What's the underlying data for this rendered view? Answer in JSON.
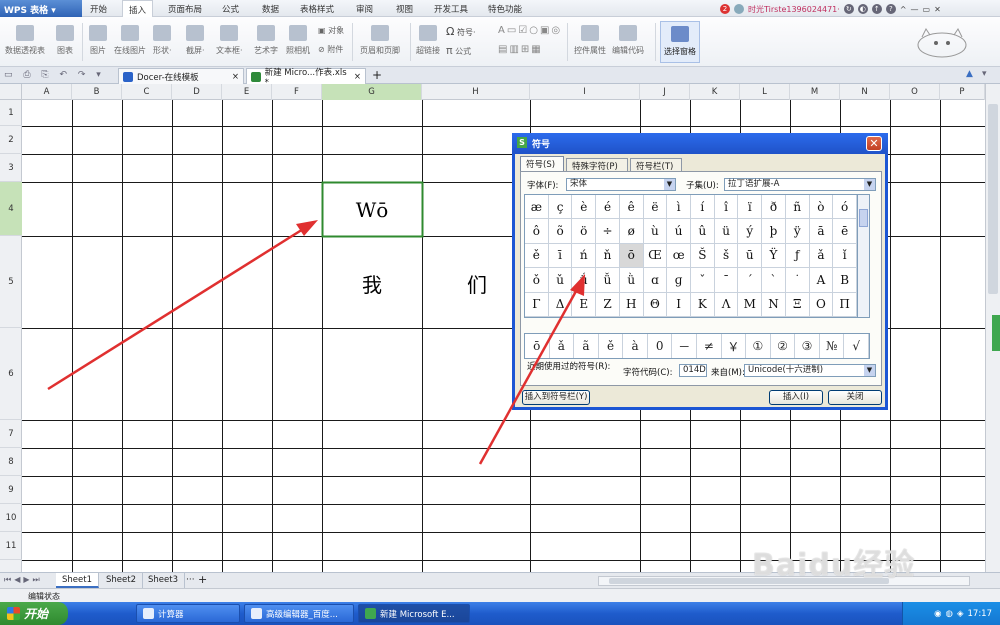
{
  "app": {
    "logo": "WPS 表格"
  },
  "menu": [
    "开始",
    "插入",
    "页面布局",
    "公式",
    "数据",
    "表格样式",
    "审阅",
    "视图",
    "开发工具",
    "特色功能"
  ],
  "menu_active_index": 1,
  "account": {
    "name": "时光Tirste1396024471·",
    "notifications": "2"
  },
  "ribbon": [
    {
      "label": "数据透视表",
      "icon": "pivot-table-icon"
    },
    {
      "label": "图表",
      "icon": "chart-icon"
    },
    {
      "label": "图片",
      "icon": "picture-icon"
    },
    {
      "label": "在线图片",
      "icon": "online-picture-icon"
    },
    {
      "label": "形状·",
      "icon": "shape-icon"
    },
    {
      "label": "截屏·",
      "icon": "screenshot-icon"
    },
    {
      "label": "文本框·",
      "icon": "textbox-icon"
    },
    {
      "label": "艺术字",
      "icon": "wordart-icon"
    },
    {
      "label": "照相机",
      "icon": "camera-icon"
    },
    {
      "label": "对象",
      "icon": "object-icon"
    },
    {
      "label": "附件",
      "icon": "attachment-icon"
    },
    {
      "label": "页眉和页脚",
      "icon": "header-footer-icon"
    },
    {
      "label": "超链接",
      "icon": "hyperlink-icon"
    },
    {
      "label": "符号·",
      "icon": "symbol-icon"
    },
    {
      "label": "公式",
      "icon": "formula-icon"
    },
    {
      "label": "控件属性",
      "icon": "control-properties-icon"
    },
    {
      "label": "编辑代码",
      "icon": "edit-code-icon"
    },
    {
      "label": "选择窗格",
      "icon": "selection-pane-icon"
    }
  ],
  "doc_tabs": [
    {
      "label": "Docer-在线模板",
      "close": "×"
    },
    {
      "label": "新建 Micro...作表.xls *",
      "close": "×"
    }
  ],
  "new_tab": "+",
  "columns": [
    "A",
    "B",
    "C",
    "D",
    "E",
    "F",
    "G",
    "H",
    "I",
    "J",
    "K",
    "L",
    "M",
    "N",
    "O",
    "P"
  ],
  "rows": [
    "1",
    "2",
    "3",
    "4",
    "5",
    "6",
    "7",
    "8",
    "9",
    "10",
    "11"
  ],
  "cells": {
    "g4": "Wō",
    "g5": "我",
    "h5": "们"
  },
  "sheets": [
    "Sheet1",
    "Sheet2",
    "Sheet3"
  ],
  "sheet_more": "···",
  "sheet_add": "+",
  "status": "编辑状态",
  "dialog": {
    "title": "符号",
    "tabs": [
      "符号(S)",
      "特殊字符(P)",
      "符号栏(T)"
    ],
    "font_label": "字体(F):",
    "font_value": "宋体",
    "subset_label": "子集(U):",
    "subset_value": "拉丁语扩展-A",
    "symbols": [
      "æ",
      "ç",
      "è",
      "é",
      "ê",
      "ë",
      "ì",
      "í",
      "î",
      "ï",
      "ð",
      "ñ",
      "ò",
      "ó",
      "ô",
      "õ",
      "ö",
      "÷",
      "ø",
      "ù",
      "ú",
      "û",
      "ü",
      "ý",
      "þ",
      "ÿ",
      "ā",
      "ē",
      "ě",
      "ī",
      "ń",
      "ň",
      "ō",
      "Œ",
      "œ",
      "Š",
      "š",
      "ū",
      "Ÿ",
      "ƒ",
      "ǎ",
      "ǐ",
      "ǒ",
      "ǔ",
      "ǘ",
      "ǚ",
      "ǜ",
      "ɑ",
      "ɡ",
      "ˇ",
      "ˉ",
      "ˊ",
      "ˋ",
      "˙",
      "Α",
      "Β",
      "Γ",
      "Δ",
      "Ε",
      "Ζ",
      "Η",
      "Θ",
      "Ι",
      "Κ",
      "Λ",
      "Μ",
      "Ν",
      "Ξ",
      "Ο",
      "Π"
    ],
    "selected_symbol_index": 32,
    "recent_label": "近期使用过的符号(R):",
    "recent": [
      "ō",
      "ǎ",
      "ã",
      "ě",
      "à",
      "0",
      "－",
      "≠",
      "￥",
      "①",
      "②",
      "③",
      "№",
      "√",
      "×"
    ],
    "code_label": "字符代码(C):",
    "code_value": "014D",
    "from_label": "来自(M):",
    "from_value": "Unicode(十六进制)",
    "insert_bar_button": "插入到符号栏(Y)",
    "insert_button": "插入(I)",
    "close_button": "关闭"
  },
  "taskbar": {
    "start": "开始",
    "items": [
      "计算器",
      "高级编辑器_百度...",
      "新建 Microsoft E..."
    ],
    "clock": "17:17"
  },
  "watermark": "Baidu经验"
}
